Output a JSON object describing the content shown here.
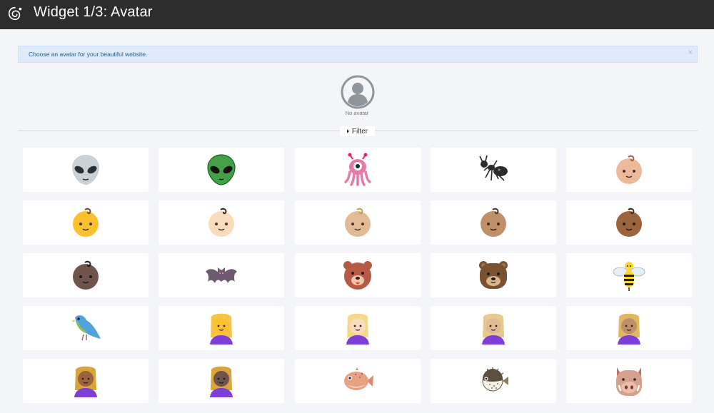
{
  "header": {
    "title": "Widget 1/3: Avatar",
    "logo_icon": "spiral-logo-icon"
  },
  "alert": {
    "text": "Choose an avatar for your beautiful website.",
    "close_label": "×"
  },
  "selected": {
    "label": "No avatar",
    "icon": "default-user-avatar-icon"
  },
  "filter": {
    "label": "Filter"
  },
  "avatars": [
    {
      "name": "alien-icon"
    },
    {
      "name": "green-alien-icon"
    },
    {
      "name": "pink-octopus-alien-icon"
    },
    {
      "name": "ant-icon"
    },
    {
      "name": "baby-light-skin-icon"
    },
    {
      "name": "baby-yellow-icon"
    },
    {
      "name": "baby-light-icon"
    },
    {
      "name": "baby-medium-light-icon"
    },
    {
      "name": "baby-medium-icon"
    },
    {
      "name": "baby-medium-dark-icon"
    },
    {
      "name": "baby-dark-icon"
    },
    {
      "name": "bat-icon"
    },
    {
      "name": "bear-red-icon"
    },
    {
      "name": "bear-brown-icon"
    },
    {
      "name": "bee-icon"
    },
    {
      "name": "bird-parrot-icon"
    },
    {
      "name": "blond-woman-yellow-icon"
    },
    {
      "name": "blond-woman-light-icon"
    },
    {
      "name": "blond-woman-medium-light-icon"
    },
    {
      "name": "blond-woman-medium-icon"
    },
    {
      "name": "blond-woman-medium-dark-icon"
    },
    {
      "name": "blond-woman-dark-icon"
    },
    {
      "name": "blowfish-icon"
    },
    {
      "name": "pufferfish-icon"
    },
    {
      "name": "boar-icon"
    }
  ]
}
